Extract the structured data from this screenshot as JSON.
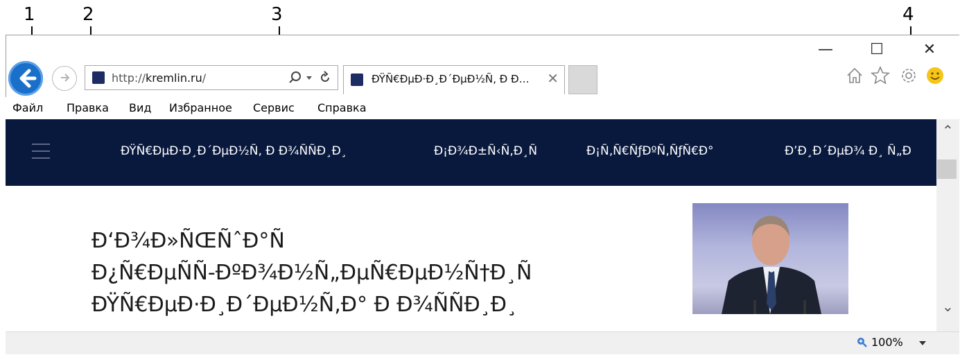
{
  "callouts": [
    "1",
    "2",
    "3",
    "4"
  ],
  "window_controls": {
    "minimize": "—",
    "maximize": "☐",
    "close": "✕"
  },
  "address_bar": {
    "prefix": "http://",
    "domain": "kremlin.ru",
    "suffix": "/"
  },
  "tab": {
    "title": "ÐŸÑ€ÐµÐ·Ð¸Ð´ÐµÐ½Ñ‚ Ð Ð…",
    "close": "✕"
  },
  "menu": [
    "Файл",
    "Правка",
    "Вид",
    "Избранное",
    "Сервис",
    "Справка"
  ],
  "site_nav": [
    "ÐŸÑ€ÐµÐ·Ð¸Ð´ÐµÐ½Ñ‚ Ð Ð¾ÑÑÐ¸Ð¸",
    "Ð¡Ð¾Ð±Ñ‹Ñ‚Ð¸Ñ",
    "Ð¡Ñ‚Ñ€ÑƒÐºÑ‚ÑƒÑ€Ð°",
    "Ð’Ð¸Ð´ÐµÐ¾ Ð¸ Ñ„Ð"
  ],
  "headline": [
    "Ð‘Ð¾Ð»ÑŒÑˆÐ°Ñ",
    "Ð¿Ñ€ÐµÑÑ-ÐºÐ¾Ð½Ñ„ÐµÑ€ÐµÐ½Ñ†Ð¸Ñ",
    "ÐŸÑ€ÐµÐ·Ð¸Ð´ÐµÐ½Ñ‚Ð° Ð Ð¾ÑÑÐ¸Ð¸"
  ],
  "zoom": "100%",
  "icons": {
    "back": "back-arrow-icon",
    "forward": "forward-arrow-icon",
    "home": "home-icon",
    "favorites": "star-icon",
    "tools": "gear-icon",
    "feedback": "smiley-icon"
  },
  "colors": {
    "site_nav_bg": "#09193e",
    "back_button": "#1a6fc9"
  }
}
